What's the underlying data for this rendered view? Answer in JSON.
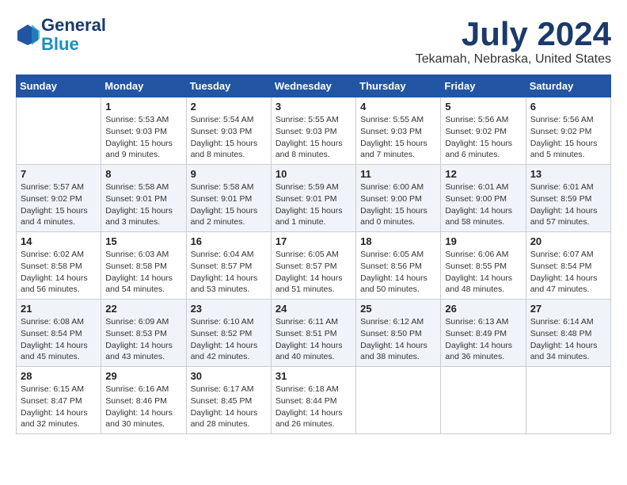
{
  "header": {
    "logo_line1": "General",
    "logo_line2": "Blue",
    "month_title": "July 2024",
    "location": "Tekamah, Nebraska, United States"
  },
  "weekdays": [
    "Sunday",
    "Monday",
    "Tuesday",
    "Wednesday",
    "Thursday",
    "Friday",
    "Saturday"
  ],
  "weeks": [
    [
      {
        "day": "",
        "empty": true
      },
      {
        "day": "1",
        "sunrise": "5:53 AM",
        "sunset": "9:03 PM",
        "daylight": "15 hours and 9 minutes."
      },
      {
        "day": "2",
        "sunrise": "5:54 AM",
        "sunset": "9:03 PM",
        "daylight": "15 hours and 8 minutes."
      },
      {
        "day": "3",
        "sunrise": "5:55 AM",
        "sunset": "9:03 PM",
        "daylight": "15 hours and 8 minutes."
      },
      {
        "day": "4",
        "sunrise": "5:55 AM",
        "sunset": "9:03 PM",
        "daylight": "15 hours and 7 minutes."
      },
      {
        "day": "5",
        "sunrise": "5:56 AM",
        "sunset": "9:02 PM",
        "daylight": "15 hours and 6 minutes."
      },
      {
        "day": "6",
        "sunrise": "5:56 AM",
        "sunset": "9:02 PM",
        "daylight": "15 hours and 5 minutes."
      }
    ],
    [
      {
        "day": "7",
        "sunrise": "5:57 AM",
        "sunset": "9:02 PM",
        "daylight": "15 hours and 4 minutes."
      },
      {
        "day": "8",
        "sunrise": "5:58 AM",
        "sunset": "9:01 PM",
        "daylight": "15 hours and 3 minutes."
      },
      {
        "day": "9",
        "sunrise": "5:58 AM",
        "sunset": "9:01 PM",
        "daylight": "15 hours and 2 minutes."
      },
      {
        "day": "10",
        "sunrise": "5:59 AM",
        "sunset": "9:01 PM",
        "daylight": "15 hours and 1 minute."
      },
      {
        "day": "11",
        "sunrise": "6:00 AM",
        "sunset": "9:00 PM",
        "daylight": "15 hours and 0 minutes."
      },
      {
        "day": "12",
        "sunrise": "6:01 AM",
        "sunset": "9:00 PM",
        "daylight": "14 hours and 58 minutes."
      },
      {
        "day": "13",
        "sunrise": "6:01 AM",
        "sunset": "8:59 PM",
        "daylight": "14 hours and 57 minutes."
      }
    ],
    [
      {
        "day": "14",
        "sunrise": "6:02 AM",
        "sunset": "8:58 PM",
        "daylight": "14 hours and 56 minutes."
      },
      {
        "day": "15",
        "sunrise": "6:03 AM",
        "sunset": "8:58 PM",
        "daylight": "14 hours and 54 minutes."
      },
      {
        "day": "16",
        "sunrise": "6:04 AM",
        "sunset": "8:57 PM",
        "daylight": "14 hours and 53 minutes."
      },
      {
        "day": "17",
        "sunrise": "6:05 AM",
        "sunset": "8:57 PM",
        "daylight": "14 hours and 51 minutes."
      },
      {
        "day": "18",
        "sunrise": "6:05 AM",
        "sunset": "8:56 PM",
        "daylight": "14 hours and 50 minutes."
      },
      {
        "day": "19",
        "sunrise": "6:06 AM",
        "sunset": "8:55 PM",
        "daylight": "14 hours and 48 minutes."
      },
      {
        "day": "20",
        "sunrise": "6:07 AM",
        "sunset": "8:54 PM",
        "daylight": "14 hours and 47 minutes."
      }
    ],
    [
      {
        "day": "21",
        "sunrise": "6:08 AM",
        "sunset": "8:54 PM",
        "daylight": "14 hours and 45 minutes."
      },
      {
        "day": "22",
        "sunrise": "6:09 AM",
        "sunset": "8:53 PM",
        "daylight": "14 hours and 43 minutes."
      },
      {
        "day": "23",
        "sunrise": "6:10 AM",
        "sunset": "8:52 PM",
        "daylight": "14 hours and 42 minutes."
      },
      {
        "day": "24",
        "sunrise": "6:11 AM",
        "sunset": "8:51 PM",
        "daylight": "14 hours and 40 minutes."
      },
      {
        "day": "25",
        "sunrise": "6:12 AM",
        "sunset": "8:50 PM",
        "daylight": "14 hours and 38 minutes."
      },
      {
        "day": "26",
        "sunrise": "6:13 AM",
        "sunset": "8:49 PM",
        "daylight": "14 hours and 36 minutes."
      },
      {
        "day": "27",
        "sunrise": "6:14 AM",
        "sunset": "8:48 PM",
        "daylight": "14 hours and 34 minutes."
      }
    ],
    [
      {
        "day": "28",
        "sunrise": "6:15 AM",
        "sunset": "8:47 PM",
        "daylight": "14 hours and 32 minutes."
      },
      {
        "day": "29",
        "sunrise": "6:16 AM",
        "sunset": "8:46 PM",
        "daylight": "14 hours and 30 minutes."
      },
      {
        "day": "30",
        "sunrise": "6:17 AM",
        "sunset": "8:45 PM",
        "daylight": "14 hours and 28 minutes."
      },
      {
        "day": "31",
        "sunrise": "6:18 AM",
        "sunset": "8:44 PM",
        "daylight": "14 hours and 26 minutes."
      },
      {
        "day": "",
        "empty": true
      },
      {
        "day": "",
        "empty": true
      },
      {
        "day": "",
        "empty": true
      }
    ]
  ]
}
